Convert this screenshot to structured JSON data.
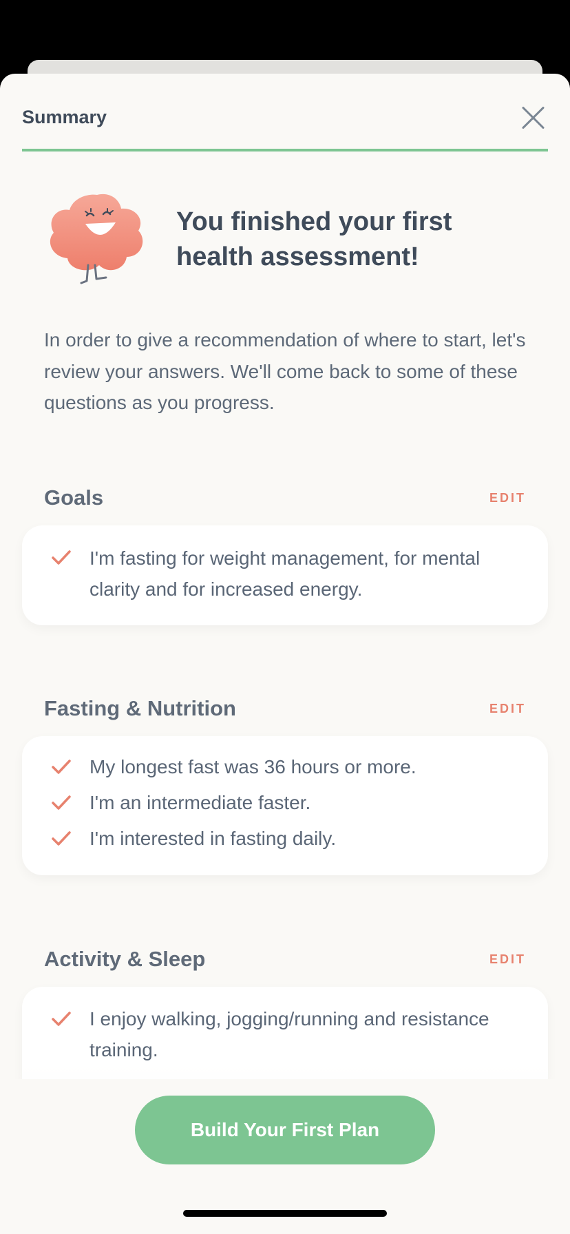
{
  "header": {
    "title": "Summary",
    "close_icon": "close-icon"
  },
  "hero": {
    "title": "You finished your first health assessment!",
    "intro": "In order to give a recommendation of where to start, let's review your answers. We'll come back to some of these questions as you progress."
  },
  "sections": [
    {
      "title": "Goals",
      "edit_label": "EDIT",
      "items": [
        "I'm fasting for weight management, for mental clarity and for increased energy."
      ]
    },
    {
      "title": "Fasting & Nutrition",
      "edit_label": "EDIT",
      "items": [
        "My longest fast was 36 hours or more.",
        "I'm an intermediate faster.",
        "I'm interested in fasting daily."
      ]
    },
    {
      "title": "Activity & Sleep",
      "edit_label": "EDIT",
      "items": [
        "I enjoy walking, jogging/running and resistance training."
      ]
    }
  ],
  "cta": {
    "label": "Build Your First Plan"
  },
  "colors": {
    "accent": "#7dc592",
    "edit": "#e7826e",
    "text": "#3f4b5a"
  }
}
